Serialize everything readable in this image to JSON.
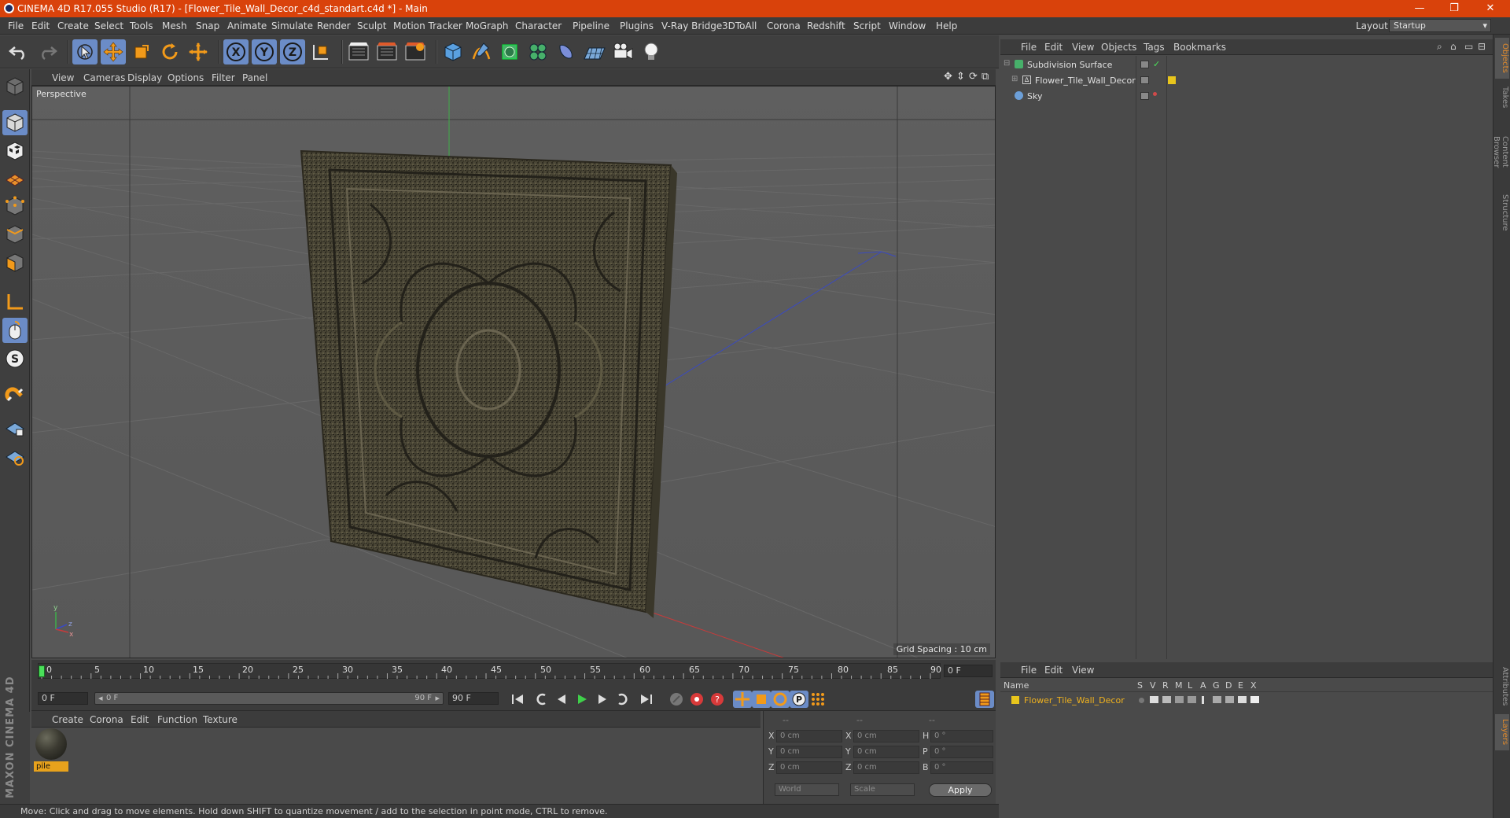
{
  "window": {
    "title": "CINEMA 4D R17.055 Studio (R17) - [Flower_Tile_Wall_Decor_c4d_standart.c4d *] - Main",
    "minimize": "—",
    "maximize": "❐",
    "close": "✕"
  },
  "menu": [
    "File",
    "Edit",
    "Create",
    "Select",
    "Tools",
    "Mesh",
    "Snap",
    "Animate",
    "Simulate",
    "Render",
    "Sculpt",
    "Motion Tracker",
    "MoGraph",
    "Character",
    "Pipeline",
    "Plugins",
    "V-Ray Bridge",
    "3DToAll",
    "Corona",
    "Redshift",
    "Script",
    "Window",
    "Help"
  ],
  "layout": {
    "label": "Layout:",
    "value": "Startup"
  },
  "viewport": {
    "menu": [
      "View",
      "Cameras",
      "Display",
      "Options",
      "Filter",
      "Panel"
    ],
    "label": "Perspective",
    "grid_spacing": "Grid Spacing : 10 cm"
  },
  "timeline": {
    "ticks": [
      "0",
      "5",
      "10",
      "15",
      "20",
      "25",
      "30",
      "35",
      "40",
      "45",
      "50",
      "55",
      "60",
      "65",
      "70",
      "75",
      "80",
      "85",
      "90"
    ],
    "current_frame": "0 F",
    "start_field": "0 F",
    "range_start": "0 F",
    "range_end": "90 F",
    "end_field": "90 F"
  },
  "material_manager": {
    "menu": [
      "Create",
      "Corona",
      "Edit",
      "Function",
      "Texture"
    ],
    "materials": [
      {
        "name": "pile"
      }
    ]
  },
  "maxon_brand": "MAXON CINEMA 4D",
  "coordinates": {
    "top_dashes": [
      "--",
      "--",
      "--"
    ],
    "rows": [
      {
        "axis1": "X",
        "pos": "0 cm",
        "axis2": "X",
        "size": "0 cm",
        "axis3": "H",
        "rot": "0 °"
      },
      {
        "axis1": "Y",
        "pos": "0 cm",
        "axis2": "Y",
        "size": "0 cm",
        "axis3": "P",
        "rot": "0 °"
      },
      {
        "axis1": "Z",
        "pos": "0 cm",
        "axis2": "Z",
        "size": "0 cm",
        "axis3": "B",
        "rot": "0 °"
      }
    ],
    "world_select": "World",
    "scale_select": "Scale",
    "apply": "Apply"
  },
  "status": "Move: Click and drag to move elements. Hold down SHIFT to quantize movement / add to the selection in point mode, CTRL to remove.",
  "objects_manager": {
    "menu": [
      "File",
      "Edit",
      "View",
      "Objects",
      "Tags",
      "Bookmarks"
    ],
    "objects": [
      {
        "name": "Subdivision Surface",
        "level": 0
      },
      {
        "name": "Flower_Tile_Wall_Decor",
        "level": 1
      },
      {
        "name": "Sky",
        "level": 0
      }
    ]
  },
  "layers_manager": {
    "menu": [
      "File",
      "Edit",
      "View"
    ],
    "columns": [
      "Name",
      "S",
      "V",
      "R",
      "M",
      "L",
      "A",
      "G",
      "D",
      "E",
      "X"
    ],
    "layers": [
      {
        "name": "Flower_Tile_Wall_Decor"
      }
    ]
  },
  "right_tabs": [
    "Objects",
    "Takes",
    "Content Browser",
    "Structure",
    "Attributes",
    "Layers"
  ],
  "colors": {
    "accent": "#d9420b",
    "active_tool": "#6b8cc7",
    "layer_name": "#f0b21e",
    "layer_color": "#e8c51c"
  }
}
